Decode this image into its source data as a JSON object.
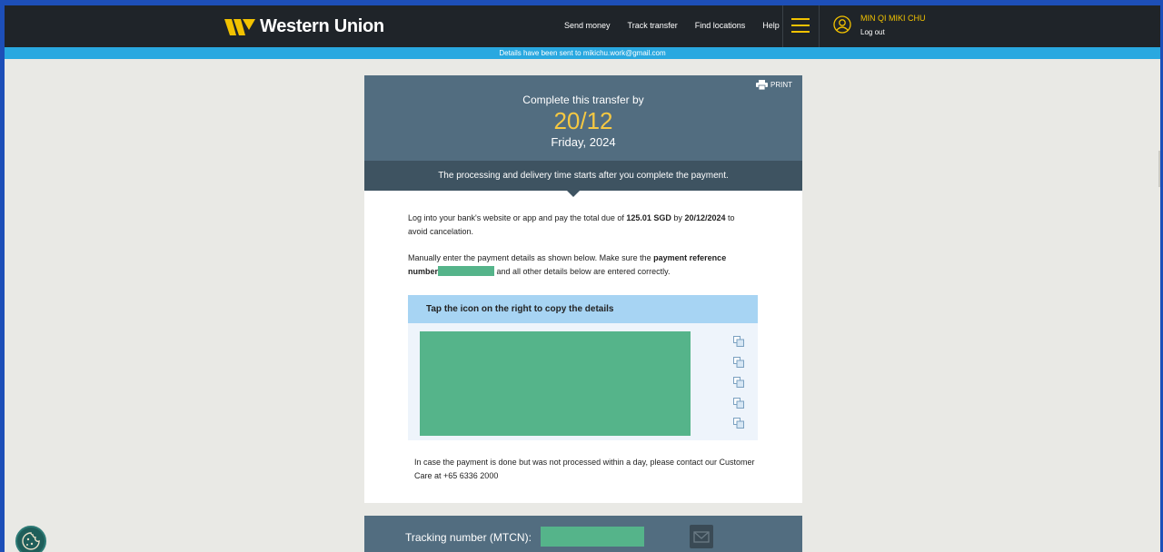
{
  "header": {
    "logo_text": "Western Union",
    "nav": [
      "Send money",
      "Track transfer",
      "Find locations",
      "Help"
    ],
    "user_name": "MIN QI MIKI CHU",
    "logout": "Log out"
  },
  "info_bar": "Details have been sent to mikichu.work@gmail.com",
  "transfer": {
    "print": "PRINT",
    "complete_by": "Complete this transfer by",
    "date": "20/12",
    "weekday": "Friday, 2024",
    "band": "The processing and delivery time starts after you complete the payment.",
    "para1_a": "Log into your bank's website or app and pay the total due of ",
    "para1_amount": "125.01 SGD",
    "para1_b": " by ",
    "para1_date": "20/12/2024",
    "para1_c": " to avoid cancelation.",
    "para2_a": "Manually enter the payment details as shown below. Make sure the ",
    "para2_bold": "payment reference number",
    "para2_b": " and all other details below are entered correctly.",
    "copy_header": "Tap the icon on the right to copy the details",
    "para3": "In case the payment is done but was not processed within a day, please contact our Customer Care at +65 6336 2000"
  },
  "tracking": {
    "label": "Tracking number (MTCN):"
  },
  "colors": {
    "header_bg": "#1f2429",
    "accent_yellow": "#f2c200",
    "info_bar": "#29a8e0",
    "card_top": "#526d80",
    "card_band": "#3e5361",
    "redaction": "#55b48a",
    "copy_header": "#a7d4f3"
  },
  "icons": [
    "wu-logo-icon",
    "hamburger-menu-icon",
    "user-avatar-icon",
    "printer-icon",
    "copy-icon",
    "mail-icon",
    "cookie-icon"
  ]
}
